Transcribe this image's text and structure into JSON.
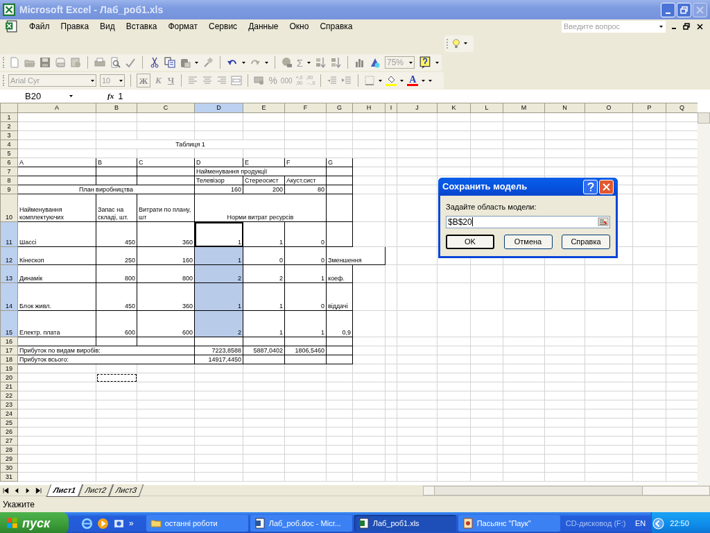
{
  "window": {
    "title": "Microsoft Excel - Лаб_роб1.xls"
  },
  "menu": [
    "Файл",
    "Правка",
    "Вид",
    "Вставка",
    "Формат",
    "Сервис",
    "Данные",
    "Окно",
    "Справка"
  ],
  "help_search": {
    "placeholder": "Введите вопрос"
  },
  "standard_toolbar": {
    "sum": "Σ",
    "zoom": "75%"
  },
  "formatting_toolbar": {
    "font": "Arial Cyr",
    "size": "10",
    "bold": "Ж",
    "italic": "К",
    "underline": "Ч",
    "percent": "%",
    "thousands": "000",
    "increase_decimal": [
      "+,0",
      ",00"
    ],
    "decrease_decimal": [
      ",00",
      "→,0"
    ],
    "font_color": "A"
  },
  "formula_bar": {
    "name_box": "B20",
    "fx": "fx",
    "value": "1"
  },
  "sheet": {
    "columns": [
      {
        "letter": "A",
        "selected": false
      },
      {
        "letter": "B",
        "selected": false
      },
      {
        "letter": "C",
        "selected": false
      },
      {
        "letter": "D",
        "selected": true
      },
      {
        "letter": "E",
        "selected": false
      },
      {
        "letter": "F",
        "selected": false
      },
      {
        "letter": "G",
        "selected": false
      },
      {
        "letter": "H",
        "selected": false
      },
      {
        "letter": "I",
        "selected": false
      },
      {
        "letter": "J",
        "selected": false
      },
      {
        "letter": "K",
        "selected": false
      },
      {
        "letter": "L",
        "selected": false
      },
      {
        "letter": "M",
        "selected": false
      },
      {
        "letter": "N",
        "selected": false
      },
      {
        "letter": "O",
        "selected": false
      },
      {
        "letter": "P",
        "selected": false
      },
      {
        "letter": "Q",
        "selected": false
      }
    ],
    "rows": [
      {
        "number": "1",
        "selected": false,
        "bordered": false
      },
      {
        "number": "2",
        "selected": false,
        "bordered": false
      },
      {
        "number": "3",
        "selected": false,
        "bordered": false
      },
      {
        "number": "4",
        "selected": false,
        "bordered": false,
        "cells": [
          {
            "kind": "blank",
            "selected": false,
            "active": false
          },
          {
            "text": "Таблиця 1",
            "kind": "title",
            "selected": false,
            "active": false
          },
          {
            "kind": "covered"
          },
          {
            "kind": "covered"
          },
          {
            "kind": "covered"
          }
        ]
      },
      {
        "number": "5",
        "selected": false,
        "bordered": false
      },
      {
        "number": "6",
        "selected": false,
        "bordered": true,
        "cells": [
          {
            "text": "A",
            "kind": "text",
            "selected": false,
            "active": false
          },
          {
            "text": "B",
            "kind": "text",
            "selected": false,
            "active": false
          },
          {
            "text": "C",
            "kind": "text",
            "selected": false,
            "active": false
          },
          {
            "text": "D",
            "kind": "text",
            "selected": false,
            "active": false
          },
          {
            "text": "E",
            "kind": "text",
            "selected": false,
            "active": false
          },
          {
            "text": "F",
            "kind": "text",
            "selected": false,
            "active": false
          },
          {
            "text": "G",
            "kind": "text",
            "selected": false,
            "active": false
          }
        ]
      },
      {
        "number": "7",
        "selected": false,
        "bordered": true,
        "cells": [
          {
            "kind": "blank",
            "selected": false,
            "active": false
          },
          {
            "kind": "blank",
            "selected": false,
            "active": false
          },
          {
            "kind": "blank",
            "selected": false,
            "active": false
          },
          {
            "text": "Найменування продукції",
            "kind": "text",
            "selected": false,
            "active": false
          },
          {
            "kind": "covered"
          },
          {
            "kind": "covered"
          }
        ]
      },
      {
        "number": "8",
        "selected": false,
        "bordered": true,
        "cells": [
          {
            "kind": "blank",
            "selected": false,
            "active": false
          },
          {
            "kind": "blank",
            "selected": false,
            "active": false
          },
          {
            "kind": "blank",
            "selected": false,
            "active": false
          },
          {
            "text": "Телевізор",
            "kind": "text",
            "selected": false,
            "active": false
          },
          {
            "text": "Стереосист",
            "kind": "text",
            "selected": false,
            "active": false
          },
          {
            "text": "Акуст.сист",
            "kind": "text",
            "selected": false,
            "active": false
          }
        ]
      },
      {
        "number": "9",
        "selected": false,
        "bordered": true,
        "cells": [
          {
            "text": "План виробництва",
            "kind": "title",
            "selected": false,
            "active": false
          },
          {
            "kind": "covered"
          },
          {
            "kind": "covered"
          },
          {
            "text": "160",
            "kind": "number",
            "selected": false,
            "active": false
          },
          {
            "text": "200",
            "kind": "number",
            "selected": false,
            "active": false
          },
          {
            "text": "80",
            "kind": "number",
            "selected": false,
            "active": false
          }
        ]
      },
      {
        "number": "10",
        "selected": false,
        "bordered": true,
        "cells": [
          {
            "text": "Найменування комплектуючих",
            "kind": "wrapped",
            "selected": false,
            "active": false
          },
          {
            "text": "Запас на складі, шт.",
            "kind": "wrapped",
            "selected": false,
            "active": false
          },
          {
            "text": "Витрати по плану, шт",
            "kind": "wrapped",
            "selected": false,
            "active": false
          },
          {
            "text": "Норми витрат ресурсів",
            "kind": "title",
            "selected": false,
            "active": false
          },
          {
            "kind": "covered"
          },
          {
            "kind": "covered"
          }
        ]
      },
      {
        "number": "11",
        "selected": true,
        "bordered": true,
        "cells": [
          {
            "text": "Шассі",
            "kind": "text",
            "selected": false,
            "active": false
          },
          {
            "text": "450",
            "kind": "number",
            "selected": false,
            "active": false
          },
          {
            "text": "360",
            "kind": "number",
            "selected": false,
            "active": false
          },
          {
            "text": "1",
            "kind": "number",
            "selected": true,
            "active": true
          },
          {
            "text": "1",
            "kind": "number",
            "selected": false,
            "active": false
          },
          {
            "text": "0",
            "kind": "number",
            "selected": false,
            "active": false
          }
        ]
      },
      {
        "number": "12",
        "selected": true,
        "bordered": true,
        "cells": [
          {
            "text": "Кінескоп",
            "kind": "text",
            "selected": false,
            "active": false
          },
          {
            "text": "250",
            "kind": "number",
            "selected": false,
            "active": false
          },
          {
            "text": "160",
            "kind": "number",
            "selected": false,
            "active": false
          },
          {
            "text": "1",
            "kind": "number",
            "selected": true,
            "active": false
          },
          {
            "text": "0",
            "kind": "number",
            "selected": false,
            "active": false
          },
          {
            "text": "0",
            "kind": "number",
            "selected": false,
            "active": false
          },
          {
            "text": "Зменшення",
            "kind": "text",
            "selected": false,
            "active": false
          },
          {
            "kind": "covered"
          }
        ]
      },
      {
        "number": "13",
        "selected": true,
        "bordered": true,
        "cells": [
          {
            "text": "Динамік",
            "kind": "text",
            "selected": false,
            "active": false
          },
          {
            "text": "800",
            "kind": "number",
            "selected": false,
            "active": false
          },
          {
            "text": "800",
            "kind": "number",
            "selected": false,
            "active": false
          },
          {
            "text": "2",
            "kind": "number",
            "selected": true,
            "active": false
          },
          {
            "text": "2",
            "kind": "number",
            "selected": false,
            "active": false
          },
          {
            "text": "1",
            "kind": "number",
            "selected": false,
            "active": false
          },
          {
            "text": "коеф.",
            "kind": "text",
            "selected": false,
            "active": false
          }
        ]
      },
      {
        "number": "14",
        "selected": true,
        "bordered": true,
        "cells": [
          {
            "text": "Блок живл.",
            "kind": "text",
            "selected": false,
            "active": false
          },
          {
            "text": "450",
            "kind": "number",
            "selected": false,
            "active": false
          },
          {
            "text": "360",
            "kind": "number",
            "selected": false,
            "active": false
          },
          {
            "text": "1",
            "kind": "number",
            "selected": true,
            "active": false
          },
          {
            "text": "1",
            "kind": "number",
            "selected": false,
            "active": false
          },
          {
            "text": "0",
            "kind": "number",
            "selected": false,
            "active": false
          },
          {
            "text": "віддачі",
            "kind": "text",
            "selected": false,
            "active": false
          }
        ]
      },
      {
        "number": "15",
        "selected": true,
        "bordered": true,
        "cells": [
          {
            "text": "Електр. плата",
            "kind": "text",
            "selected": false,
            "active": false
          },
          {
            "text": "600",
            "kind": "number",
            "selected": false,
            "active": false
          },
          {
            "text": "600",
            "kind": "number",
            "selected": false,
            "active": false
          },
          {
            "text": "2",
            "kind": "number",
            "selected": true,
            "active": false
          },
          {
            "text": "1",
            "kind": "number",
            "selected": false,
            "active": false
          },
          {
            "text": "1",
            "kind": "number",
            "selected": false,
            "active": false
          },
          {
            "text": "0,9",
            "kind": "number",
            "selected": false,
            "active": false
          }
        ]
      },
      {
        "number": "16",
        "selected": false,
        "bordered": true
      },
      {
        "number": "17",
        "selected": false,
        "bordered": true,
        "cells": [
          {
            "text": "Прибуток по видам виробів:",
            "kind": "text",
            "selected": false,
            "active": false
          },
          {
            "kind": "covered"
          },
          {
            "kind": "covered"
          },
          {
            "text": "7223,8588",
            "kind": "number",
            "selected": false,
            "active": false
          },
          {
            "text": "5887,0402",
            "kind": "number",
            "selected": false,
            "active": false
          },
          {
            "text": "1806,5460",
            "kind": "number",
            "selected": false,
            "active": false
          }
        ]
      },
      {
        "number": "18",
        "selected": false,
        "bordered": true,
        "cells": [
          {
            "text": "Прибуток всього:",
            "kind": "text",
            "selected": false,
            "active": false
          },
          {
            "kind": "covered"
          },
          {
            "kind": "covered"
          },
          {
            "text": "14917,4450",
            "kind": "number",
            "selected": false,
            "active": false
          }
        ]
      },
      {
        "number": "19",
        "selected": false,
        "bordered": false
      },
      {
        "number": "20",
        "selected": false,
        "bordered": false,
        "cells": [
          {
            "kind": "blank",
            "selected": false,
            "active": false
          },
          {
            "kind": "marquee",
            "selected": false,
            "active": false
          }
        ]
      },
      {
        "number": "21",
        "selected": false,
        "bordered": false
      },
      {
        "number": "22",
        "selected": false,
        "bordered": false
      },
      {
        "number": "23",
        "selected": false,
        "bordered": false
      },
      {
        "number": "24",
        "selected": false,
        "bordered": false
      },
      {
        "number": "25",
        "selected": false,
        "bordered": false
      },
      {
        "number": "26",
        "selected": false,
        "bordered": false
      },
      {
        "number": "27",
        "selected": false,
        "bordered": false
      },
      {
        "number": "28",
        "selected": false,
        "bordered": false
      },
      {
        "number": "29",
        "selected": false,
        "bordered": false
      },
      {
        "number": "30",
        "selected": false,
        "bordered": false
      },
      {
        "number": "31",
        "selected": false,
        "bordered": false
      }
    ]
  },
  "sheet_tabs": [
    {
      "label": "Лист1",
      "selected": true
    },
    {
      "label": "Лист2",
      "selected": false
    },
    {
      "label": "Лист3",
      "selected": false
    }
  ],
  "status_bar": "Укажите",
  "dialog": {
    "title": "Сохранить модель",
    "label": "Задайте область модели:",
    "value": "$B$20",
    "buttons": [
      {
        "label": "OK",
        "default": true
      },
      {
        "label": "Отмена",
        "default": false
      },
      {
        "label": "Справка",
        "default": false
      }
    ]
  },
  "taskbar": {
    "start": "пуск",
    "more": "»",
    "tasks": [
      {
        "label": "останні роботи",
        "kind": "folder",
        "selected": false
      },
      {
        "label": "Лаб_роб.doc - Micr...",
        "kind": "word",
        "selected": false
      },
      {
        "label": "Лаб_роб1.xls",
        "kind": "excel",
        "selected": true
      },
      {
        "label": "Пасьянс \"Паук\"",
        "kind": "game",
        "selected": false
      }
    ],
    "drive": "CD-дисковод (F:)",
    "language": "EN",
    "clock": "22:50"
  }
}
